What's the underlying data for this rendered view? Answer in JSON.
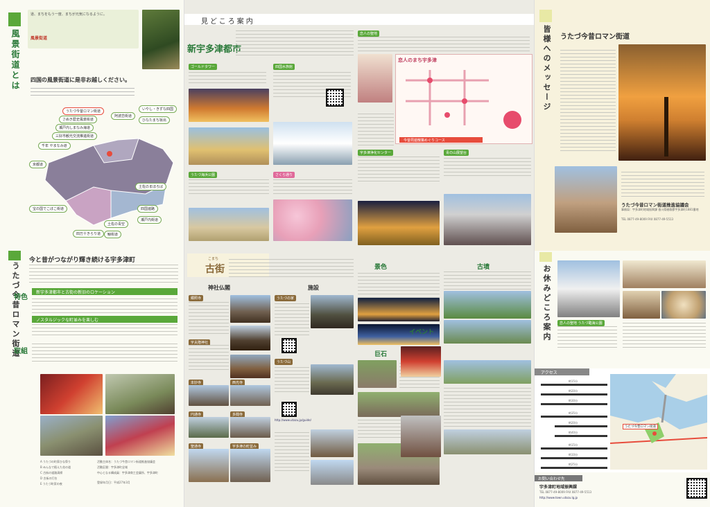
{
  "left": {
    "scenic_title": "風景街道とは",
    "scenic_heading": "四国の風景街道に是非お越しください。",
    "scenic_intro": "道、まちをもう一度、まちが元気になるように。",
    "scenic_sub": "風景街道",
    "map_labels": [
      "うたづ今昔ロマン街道",
      "さぬき歴史風景街道",
      "瀬戸内しまなみ海道",
      "三好市観光交流推進街道",
      "千年 やまなみ道",
      "阿波恋街道",
      "京都道",
      "宝の国でこぼこ街道",
      "土佐の青空",
      "四万十きらり道",
      "鯨街道",
      "いやし・きずな四国",
      "ひなたまち坂出",
      "土佐のまほろば",
      "四国遍路",
      "瀬戸内街道"
    ],
    "roman_title": "うたづ今昔ロマン街道",
    "roman_heading": "今と昔がつながり輝き続ける宇多津町",
    "feature_label": "特色",
    "feature_box1": "新宇多津都市と古街の新旧のロケーション",
    "feature_box2": "ノスタルジックな町並みを楽しむ",
    "effort_label": "取組",
    "effort_items": [
      "A うたづの町家ひな祭り",
      "B みんなで植えた花の道",
      "C 古街の道路清掃",
      "D 古街の灯台",
      "E うたづ町家の夜"
    ],
    "info_rows": [
      "活動主体名：うたづ今昔ロマン街道推進協議会",
      "活動区間：宇多津町全域",
      "中心となる構成員：宇多津商工会議所、宇多津町",
      "登録年月日：平成27年3月"
    ]
  },
  "middle": {
    "section_title": "見どころ案内",
    "new_city_title": "新宇多津都市",
    "old_town_title": "古街",
    "old_town_ruby": "こまち",
    "goshoku": "神社仏閣",
    "shisetsu": "施設",
    "keshiki": "景色",
    "kyoseki": "巨石",
    "kofun": "古墳",
    "event": "イベント",
    "spots_new": [
      "ゴールドタワー",
      "四国水族館",
      "うたづ海浜公園",
      "うたづ臨海公園",
      "さくら通り",
      "恋人の聖地",
      "宇多津浄化センター",
      "青の山展望台"
    ],
    "spots_old": [
      "郷照寺",
      "宇夫階神社",
      "うたづの家",
      "うたづ山",
      "本妙寺",
      "西光寺",
      "円通寺",
      "多聞寺",
      "聖通寺",
      "宇多津の町並み"
    ],
    "courses": "今昔周遊散策めぐりコース",
    "love_map_title": "恋人のまち宇多津",
    "urls": [
      "http://www.town.utazu.lg.jp",
      "http://www.utazu.jp/guide/",
      "http://shikoku-aquarium.jp"
    ]
  },
  "right": {
    "message_title": "皆様へのメッセージ",
    "roman_title": "うたづ今昔ロマン街道",
    "org_name": "うたづ今昔ロマン街道推進協議会",
    "org_address": "事務局：宇多津町地域振興課 香川県綾歌郡宇多津町1881番地",
    "org_tel": "TEL 0877-49-8009  FAX 0877-49-5513",
    "rest_title": "お休みどころ案内",
    "rest_spots": [
      "恋人の聖地 うたづ臨海公園",
      "臨海公園内カフェ",
      "道の駅 うたづ臨海公園"
    ],
    "access_title": "アクセス",
    "access_times": [
      "約15分",
      "約20分",
      "約30分",
      "約35分",
      "約20分",
      "約40分",
      "約15分",
      "約10分",
      "約25分"
    ],
    "map_label": "うたづ今昔ロマン街道",
    "contact_title": "お問い合わせ先",
    "contact_org": "宇多津町地域振興課"
  },
  "colors": {
    "green": "#5aa83a",
    "purple": "#8a3b8c",
    "olive": "#8a8a3a",
    "orange": "#e48a23",
    "cream": "#f7f2dd",
    "roman_yellow": "#e8e9a5"
  }
}
